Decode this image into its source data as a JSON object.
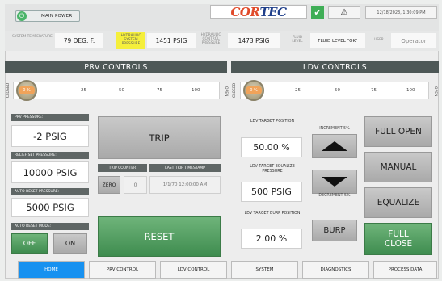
{
  "header": {
    "main_power": "MAIN POWER",
    "logo_part1": "C",
    "logo_part2": "OR",
    "logo_part3": "TEC",
    "datetime": "12/18/2023, 1:30:09 PM",
    "check_glyph": "✔",
    "warn_glyph": "⚠",
    "power_glyph": "⏻"
  },
  "status": {
    "system_temp_label": "SYSTEM TEMPERATURE",
    "system_temp_value": "79 DEG. F.",
    "hyd_sys_label": "HYDRAULIC SYSTEM PRESSURE",
    "hyd_sys_value": "1451 PSIG",
    "hyd_ctrl_label": "HYDRAULIC CONTROL PRESSURE",
    "hyd_ctrl_value": "1473 PSIG",
    "fluid_label": "FLUID LEVEL",
    "fluid_value": "FLUID LEVEL \"OK\"",
    "user_label": "USER",
    "user_value": "Operator"
  },
  "prv": {
    "title": "PRV CONTROLS",
    "closed": "CLOSED",
    "open": "OPEN",
    "knob": "0 %",
    "ticks": [
      "25",
      "50",
      "75",
      "100"
    ],
    "pressure_label": "PRV PRESSURE:",
    "pressure_value": "-2 PSIG",
    "relief_label": "RELIEF SET PRESSURE:",
    "relief_value": "10000 PSIG",
    "auto_reset_label": "AUTO RESET PRESSURE:",
    "auto_reset_value": "5000 PSIG",
    "auto_mode_label": "AUTO RESET MODE:",
    "off": "OFF",
    "on": "ON",
    "trip": "TRIP",
    "trip_counter_label": "TRIP COUNTER",
    "last_trip_label": "LAST TRIP TIMESTAMP",
    "zero": "ZERO",
    "trip_count": "0",
    "last_trip": "1/1/70 12:00:00 AM",
    "reset": "RESET"
  },
  "ldv": {
    "title": "LDV CONTROLS",
    "closed": "CLOSED",
    "open": "OPEN",
    "knob": "0 %",
    "ticks": [
      "25",
      "50",
      "75",
      "100"
    ],
    "target_pos_label": "LDV TARGET POSITION",
    "target_pos_value": "50.00 %",
    "equalize_label": "LDV TARGET EQUALIZE PRESSURE",
    "equalize_value": "500 PSIG",
    "burp_label": "LDV TARGET BURP POSITION",
    "burp_value": "2.00 %",
    "increment": "INCREMENT 5%",
    "decrement": "DECREMENT 5%",
    "burp": "BURP",
    "full_open": "FULL OPEN",
    "manual": "MANUAL",
    "equalize": "EQUALIZE",
    "full_close": "FULL CLOSE"
  },
  "nav": [
    "HOME",
    "PRV CONTROL",
    "LDV CONTROL",
    "SYSTEM",
    "DIAGNOSTICS",
    "PROCESS DATA"
  ]
}
